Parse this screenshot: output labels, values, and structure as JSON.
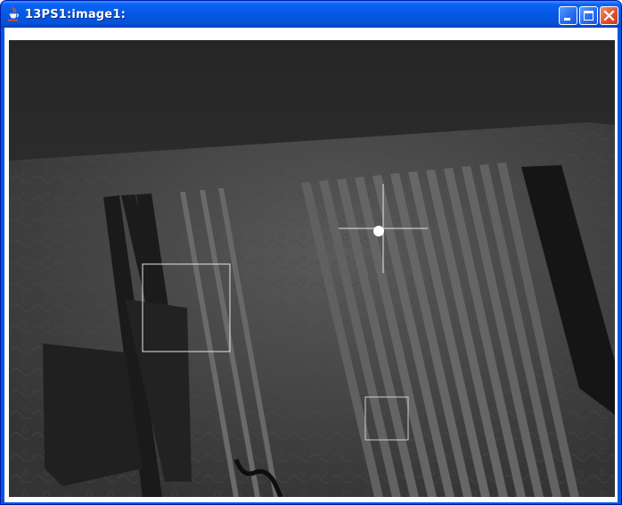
{
  "window": {
    "title": "13PS1:image1:",
    "app_icon": "java-cup-icon",
    "buttons": {
      "minimize": "minimize-icon",
      "maximize": "maximize-icon",
      "close": "close-icon"
    }
  },
  "image_view": {
    "content": "camera-feed",
    "overlays": [
      "crosshair",
      "roi-box",
      "roi-box"
    ]
  },
  "colors": {
    "titlebar": "#0558e3",
    "frame": "#0a53e0",
    "close_button": "#e0512c",
    "overlay": "#ffffff"
  }
}
